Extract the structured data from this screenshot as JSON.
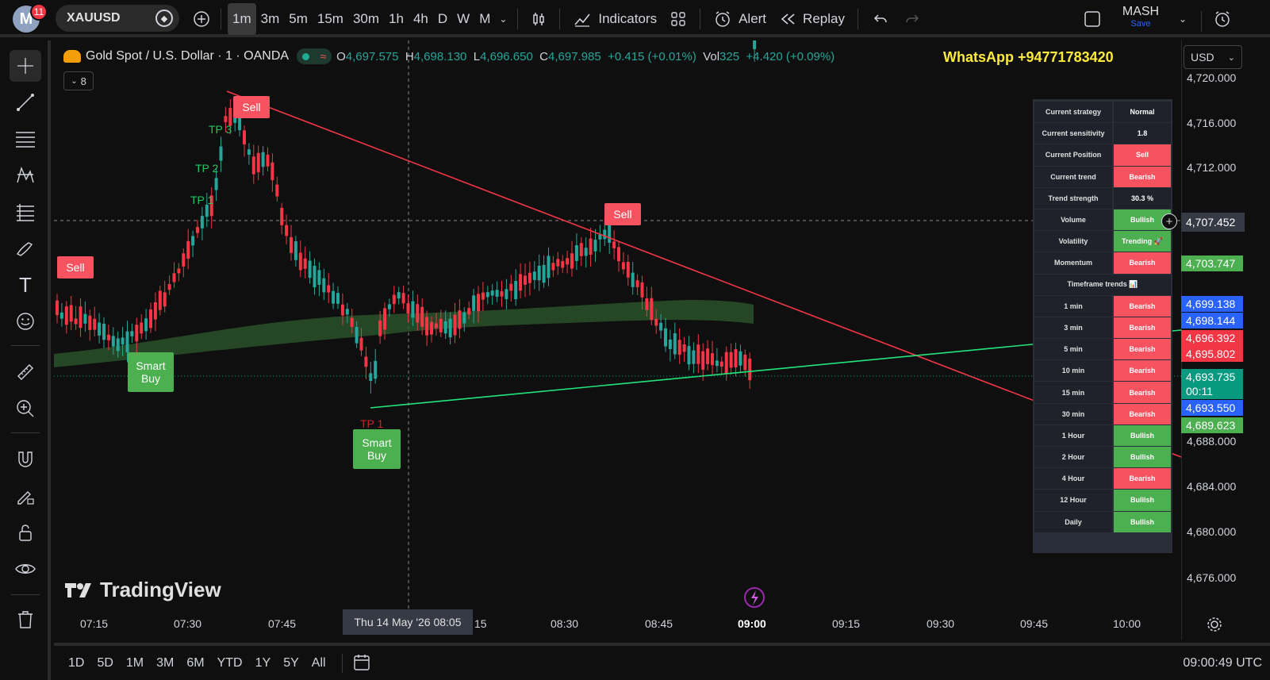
{
  "topbar": {
    "notifications": "11",
    "avatar_letter": "M",
    "symbol": "XAUUSD",
    "timeframes": [
      "1m",
      "3m",
      "5m",
      "15m",
      "30m",
      "1h",
      "4h",
      "D",
      "W",
      "M"
    ],
    "active_timeframe": "1m",
    "indicators_label": "Indicators",
    "alert_label": "Alert",
    "replay_label": "Replay",
    "layout_name": "MASH",
    "layout_save": "Save"
  },
  "legend": {
    "title": "Gold Spot / U.S. Dollar · 1 · OANDA",
    "open_label": "O",
    "open": "4,697.575",
    "high_label": "H",
    "high": "4,698.130",
    "low_label": "L",
    "low": "4,696.650",
    "close_label": "C",
    "close": "4,697.985",
    "change": "+0.415 (+0.01%)",
    "vol_label": "Vol",
    "vol": "325",
    "vol_change": "+4.420 (+0.09%)",
    "collapse_count": "8"
  },
  "overlay_text": "WhatsApp +94771783420",
  "currency": "USD",
  "strategy_table": [
    {
      "label": "Current strategy",
      "value": "Normal",
      "color": "#1f222b"
    },
    {
      "label": "Current sensitivity",
      "value": "1.8",
      "color": "#1f222b"
    },
    {
      "label": "Current Position",
      "value": "Sell",
      "color": "#f7525f"
    },
    {
      "label": "Current trend",
      "value": "Bearish",
      "color": "#f7525f"
    },
    {
      "label": "Trend strength",
      "value": "30.3 %",
      "color": "#1f222b"
    },
    {
      "label": "Volume",
      "value": "Bullish",
      "color": "#4caf50"
    },
    {
      "label": "Volatility",
      "value": "Trending 🚀",
      "color": "#4caf50"
    },
    {
      "label": "Momentum",
      "value": "Bearish",
      "color": "#f7525f"
    },
    {
      "label": "Timeframe trends 📊",
      "value": null,
      "color": "#1f222b"
    },
    {
      "label": "1 min",
      "value": "Bearish",
      "color": "#f7525f"
    },
    {
      "label": "3 min",
      "value": "Bearish",
      "color": "#f7525f"
    },
    {
      "label": "5 min",
      "value": "Bearish",
      "color": "#f7525f"
    },
    {
      "label": "10 min",
      "value": "Bearish",
      "color": "#f7525f"
    },
    {
      "label": "15 min",
      "value": "Bearish",
      "color": "#f7525f"
    },
    {
      "label": "30 min",
      "value": "Bearish",
      "color": "#f7525f"
    },
    {
      "label": "1 Hour",
      "value": "Bullish",
      "color": "#4caf50"
    },
    {
      "label": "2 Hour",
      "value": "Bullish",
      "color": "#4caf50"
    },
    {
      "label": "4 Hour",
      "value": "Bearish",
      "color": "#f7525f"
    },
    {
      "label": "12 Hour",
      "value": "Bullish",
      "color": "#4caf50"
    },
    {
      "label": "Daily",
      "value": "Bullish",
      "color": "#4caf50"
    }
  ],
  "price_ticks": [
    "4,720.000",
    "4,716.000",
    "4,712.000",
    "4,703.747",
    "4,688.000",
    "4,684.000",
    "4,680.000",
    "4,676.000"
  ],
  "price_tags": [
    {
      "value": "4,707.452",
      "color": "#363a45"
    },
    {
      "value": "4,703.747",
      "color": "#4caf50"
    },
    {
      "value": "4,699.138",
      "color": "#2962ff"
    },
    {
      "value": "4,698.144",
      "color": "#2962ff"
    },
    {
      "value": "4,696.392",
      "color": "#f23645"
    },
    {
      "value": "4,695.802",
      "color": "#f23645"
    },
    {
      "value": "4,693.735",
      "color": "#089981"
    },
    {
      "value": "00:11",
      "color": "#089981"
    },
    {
      "value": "4,693.550",
      "color": "#2962ff"
    },
    {
      "value": "4,689.623",
      "color": "#4caf50"
    }
  ],
  "time_ticks": [
    "07:15",
    "07:30",
    "07:45",
    "15",
    "08:30",
    "08:45",
    "09:00",
    "09:15",
    "09:30",
    "09:45",
    "10:00"
  ],
  "crosshair_time": "Thu 14 May '26   08:05",
  "signals": {
    "sell": "Sell",
    "smart_buy_line1": "Smart",
    "smart_buy_line2": "Buy",
    "tp1": "TP 1",
    "tp2": "TP 2",
    "tp3": "TP 3"
  },
  "watermark": "TradingView",
  "ranges": [
    "1D",
    "5D",
    "1M",
    "3M",
    "6M",
    "YTD",
    "1Y",
    "5Y",
    "All"
  ],
  "clock": "09:00:49 UTC"
}
